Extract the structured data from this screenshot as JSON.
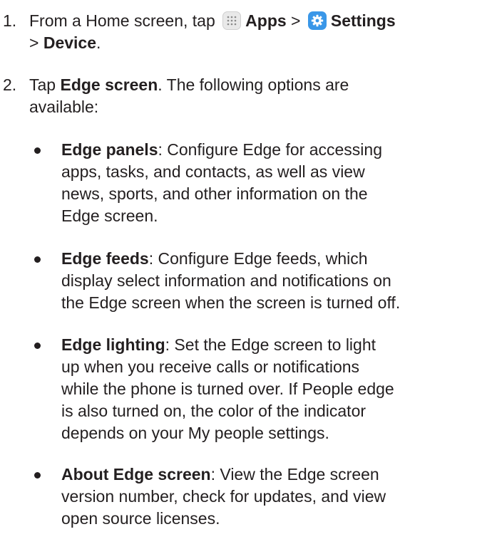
{
  "steps": [
    {
      "number": "1.",
      "prefix": "From a Home screen, tap",
      "apps_label": "Apps",
      "sep": ">",
      "settings_label": "Settings",
      "line2_sep": ">",
      "device_label": "Device",
      "end": ".",
      "icons": [
        "apps-grid-icon",
        "settings-gear-icon"
      ]
    },
    {
      "number": "2.",
      "tap": "Tap",
      "edge_screen": "Edge screen",
      "rest_line1": ". The following options are",
      "rest_line2": "available:"
    }
  ],
  "options": [
    {
      "term": "Edge panels",
      "lines": [
        ": Configure Edge for accessing",
        "apps, tasks, and contacts, as well as view",
        "news, sports, and other information on the",
        "Edge screen."
      ]
    },
    {
      "term": "Edge feeds",
      "lines": [
        ": Configure Edge feeds, which",
        "display select information and notifications on",
        "the Edge screen when the screen is turned off."
      ]
    },
    {
      "term": "Edge lighting",
      "lines": [
        ": Set the Edge screen to light",
        "up when you receive calls or notifications",
        "while the phone is turned over. If People edge",
        "is also turned on, the color of the indicator",
        "depends on your My people settings."
      ]
    },
    {
      "term": "About Edge screen",
      "lines": [
        ": View the Edge screen",
        "version number, check for updates, and view",
        "open source licenses."
      ]
    }
  ],
  "colors": {
    "text": "#231f20",
    "settings_icon": "#3a97e8",
    "apps_icon": "#e9e9e9"
  }
}
